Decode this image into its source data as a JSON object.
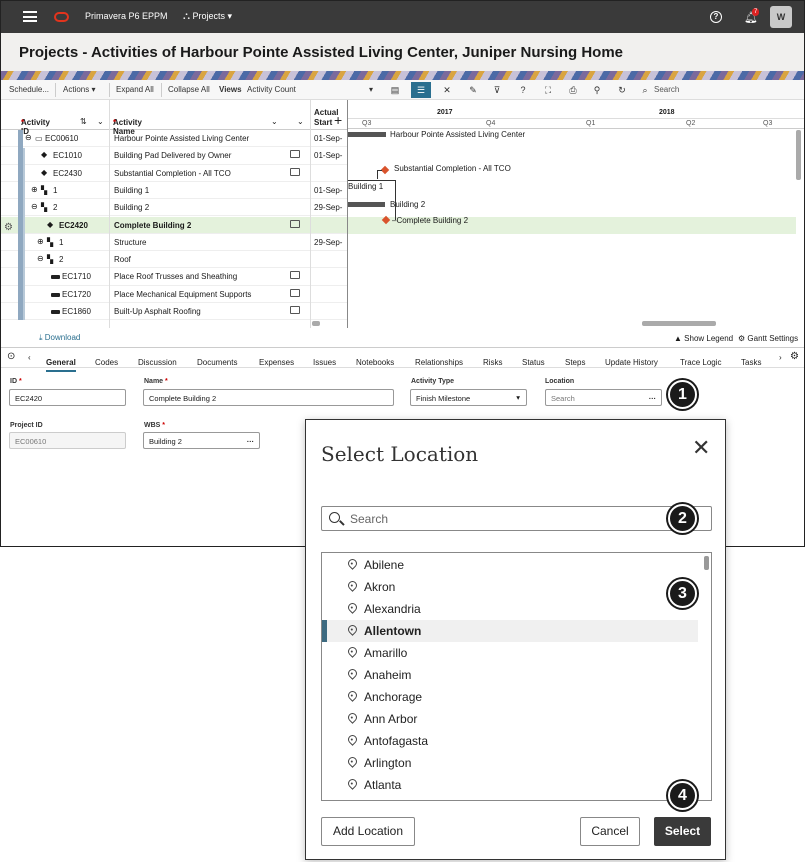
{
  "topbar": {
    "app_name": "Primavera P6 EPPM",
    "projects_menu": "Projects ▾",
    "notification_count": "7",
    "avatar": "W"
  },
  "page_title": "Projects - Activities of Harbour Pointe Assisted Living Center, Juniper Nursing Home",
  "toolbar": {
    "schedule": "Schedule...",
    "actions": "Actions ▾",
    "expand_all": "Expand All",
    "collapse_all": "Collapse All",
    "views_label": "Views",
    "views_value": "Activity Count",
    "search_placeholder": "Search"
  },
  "grid": {
    "col_activity_id": "Activity ID",
    "col_activity_name": "Activity Name",
    "col_actual_start_1": "Actual",
    "col_actual_start_2": "Start",
    "rows": [
      {
        "id": "EC00610",
        "name": "Harbour Pointe Assisted Living Center",
        "start": "01-Sep-"
      },
      {
        "id": "EC1010",
        "name": "Building Pad Delivered by Owner",
        "start": "01-Sep-"
      },
      {
        "id": "EC2430",
        "name": "Substantial Completion - All TCO",
        "start": ""
      },
      {
        "id": "1",
        "name": "Building 1",
        "start": "01-Sep-"
      },
      {
        "id": "2",
        "name": "Building 2",
        "start": "29-Sep-"
      },
      {
        "id": "EC2420",
        "name": "Complete Building 2",
        "start": ""
      },
      {
        "id": "1",
        "name": "Structure",
        "start": "29-Sep-"
      },
      {
        "id": "2",
        "name": "Roof",
        "start": ""
      },
      {
        "id": "EC1710",
        "name": "Place Roof Trusses and Sheathing",
        "start": ""
      },
      {
        "id": "EC1720",
        "name": "Place Mechanical Equipment Supports",
        "start": ""
      },
      {
        "id": "EC1860",
        "name": "Built-Up Asphalt Roofing",
        "start": ""
      }
    ]
  },
  "gantt": {
    "years": [
      "2017",
      "2018"
    ],
    "quarters": [
      "Q3",
      "Q4",
      "Q1",
      "Q2",
      "Q3"
    ],
    "labels": {
      "hp": "Harbour Pointe Assisted Living Center",
      "sc": "Substantial Completion - All TCO",
      "b1": "Building 1",
      "b2": "Building 2",
      "cb2": "Complete Building 2"
    }
  },
  "footer": {
    "download": "Download",
    "show_legend": "Show Legend",
    "gantt_settings": "Gantt Settings"
  },
  "tabs": [
    "General",
    "Codes",
    "Discussion",
    "Documents",
    "Expenses",
    "Issues",
    "Notebooks",
    "Relationships",
    "Risks",
    "Status",
    "Steps",
    "Update History",
    "Trace Logic",
    "Tasks"
  ],
  "form": {
    "id_label": "ID",
    "id_value": "EC2420",
    "name_label": "Name",
    "name_value": "Complete Building 2",
    "activity_type_label": "Activity Type",
    "activity_type_value": "Finish Milestone",
    "location_label": "Location",
    "location_placeholder": "Search",
    "project_id_label": "Project ID",
    "project_id_value": "EC00610",
    "wbs_label": "WBS",
    "wbs_value": "Building 2"
  },
  "dialog": {
    "title": "Select Location",
    "search_placeholder": "Search",
    "locations": [
      "Abilene",
      "Akron",
      "Alexandria",
      "Allentown",
      "Amarillo",
      "Anaheim",
      "Anchorage",
      "Ann Arbor",
      "Antofagasta",
      "Arlington",
      "Atlanta"
    ],
    "selected": "Allentown",
    "add_location": "Add Location",
    "cancel": "Cancel",
    "select": "Select"
  },
  "callouts": [
    "1",
    "2",
    "3",
    "4"
  ]
}
